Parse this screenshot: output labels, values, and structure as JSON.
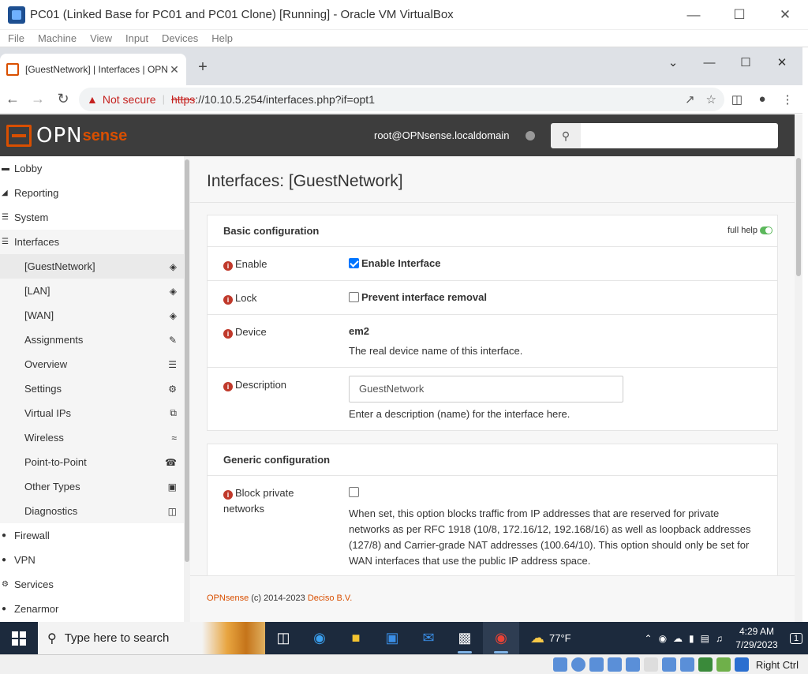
{
  "vbox": {
    "title": "PC01 (Linked Base for PC01 and PC01 Clone) [Running] - Oracle VM VirtualBox",
    "menu": [
      "File",
      "Machine",
      "View",
      "Input",
      "Devices",
      "Help"
    ],
    "host_key": "Right Ctrl"
  },
  "browser": {
    "tab_title": "[GuestNetwork] | Interfaces | OPNsense",
    "not_secure": "Not secure",
    "scheme": "https",
    "url": "://10.10.5.254/interfaces.php?if=opt1"
  },
  "header": {
    "logo_main": "OPN",
    "logo_sub": "sense",
    "user": "root@OPNsense.localdomain",
    "search_placeholder": ""
  },
  "sidebar": {
    "items": [
      {
        "label": "Lobby",
        "level": "top"
      },
      {
        "label": "Reporting",
        "level": "top"
      },
      {
        "label": "System",
        "level": "top"
      },
      {
        "label": "Interfaces",
        "level": "top"
      },
      {
        "label": "[GuestNetwork]",
        "level": "sub",
        "icon": "network-icon"
      },
      {
        "label": "[LAN]",
        "level": "sub",
        "icon": "network-icon"
      },
      {
        "label": "[WAN]",
        "level": "sub",
        "icon": "network-icon"
      },
      {
        "label": "Assignments",
        "level": "sub",
        "icon": "pencil-icon"
      },
      {
        "label": "Overview",
        "level": "sub",
        "icon": "list-icon"
      },
      {
        "label": "Settings",
        "level": "sub",
        "icon": "cogs-icon"
      },
      {
        "label": "Virtual IPs",
        "level": "sub",
        "icon": "clone-icon"
      },
      {
        "label": "Wireless",
        "level": "sub",
        "icon": "wifi-icon"
      },
      {
        "label": "Point-to-Point",
        "level": "sub",
        "icon": "phone-icon"
      },
      {
        "label": "Other Types",
        "level": "sub",
        "icon": "archive-icon"
      },
      {
        "label": "Diagnostics",
        "level": "sub",
        "icon": "medkit-icon"
      },
      {
        "label": "Firewall",
        "level": "top"
      },
      {
        "label": "VPN",
        "level": "top"
      },
      {
        "label": "Services",
        "level": "top"
      },
      {
        "label": "Zenarmor",
        "level": "top"
      }
    ]
  },
  "main": {
    "page_title": "Interfaces: [GuestNetwork]",
    "basic": {
      "heading": "Basic configuration",
      "full_help": "full help",
      "enable_label": "Enable",
      "enable_text": "Enable Interface",
      "lock_label": "Lock",
      "lock_text": "Prevent interface removal",
      "device_label": "Device",
      "device_value": "em2",
      "device_hint": "The real device name of this interface.",
      "desc_label": "Description",
      "desc_value": "GuestNetwork",
      "desc_hint": "Enter a description (name) for the interface here."
    },
    "generic": {
      "heading": "Generic configuration",
      "block_label": "Block private networks",
      "block_hint": "When set, this option blocks traffic from IP addresses that are reserved for private networks as per RFC 1918 (10/8, 172.16/12, 192.168/16) as well as loopback addresses (127/8) and Carrier-grade NAT addresses (100.64/10). This option should only be set for WAN interfaces that use the public IP address space."
    },
    "footer": {
      "brand": "OPNsense",
      "copy": "(c) 2014-2023",
      "company": "Deciso B.V."
    }
  },
  "taskbar": {
    "search_placeholder": "Type here to search",
    "temperature": "77°F",
    "time": "4:29 AM",
    "date": "7/29/2023",
    "notifications": "1"
  }
}
